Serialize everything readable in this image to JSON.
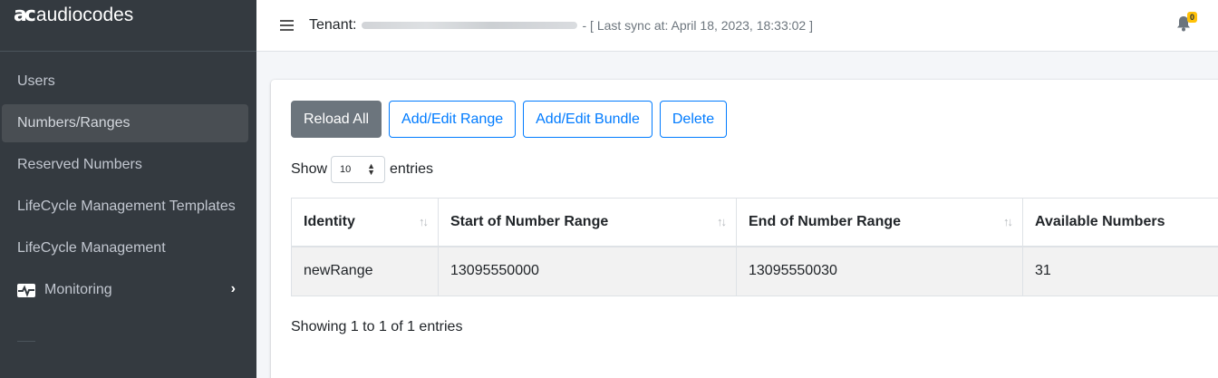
{
  "brand": {
    "mark": "ac",
    "name": "audiocodes"
  },
  "sidebar": {
    "items": [
      {
        "label": "Users",
        "active": false
      },
      {
        "label": "Numbers/Ranges",
        "active": true
      },
      {
        "label": "Reserved Numbers",
        "active": false
      },
      {
        "label": "LifeCycle Management Templates",
        "active": false
      },
      {
        "label": "LifeCycle Management",
        "active": false
      },
      {
        "label": "Monitoring",
        "active": false,
        "icon": "monitor-pulse-icon",
        "has_submenu": true
      }
    ]
  },
  "header": {
    "tenant_label": "Tenant:",
    "tenant_value_state": "blurred",
    "sync_text": "- [ Last sync at: April 18, 2023, 18:33:02 ]",
    "notification_count": "0"
  },
  "toolbar": {
    "reload_all": "Reload All",
    "add_edit_range": "Add/Edit Range",
    "add_edit_bundle": "Add/Edit Bundle",
    "delete": "Delete"
  },
  "length_menu": {
    "show": "Show",
    "value": "10",
    "entries": "entries"
  },
  "table": {
    "columns": [
      "Identity",
      "Start of Number Range",
      "End of Number Range",
      "Available Numbers"
    ],
    "rows": [
      [
        "newRange",
        "13095550000",
        "13095550030",
        "31"
      ]
    ]
  },
  "info_text": "Showing 1 to 1 of 1 entries",
  "colors": {
    "sidebar_bg": "#343a40",
    "active_item_bg": "#494e53",
    "primary_outline": "#007bff",
    "secondary_btn": "#6c757d",
    "badge": "#ffc107"
  }
}
